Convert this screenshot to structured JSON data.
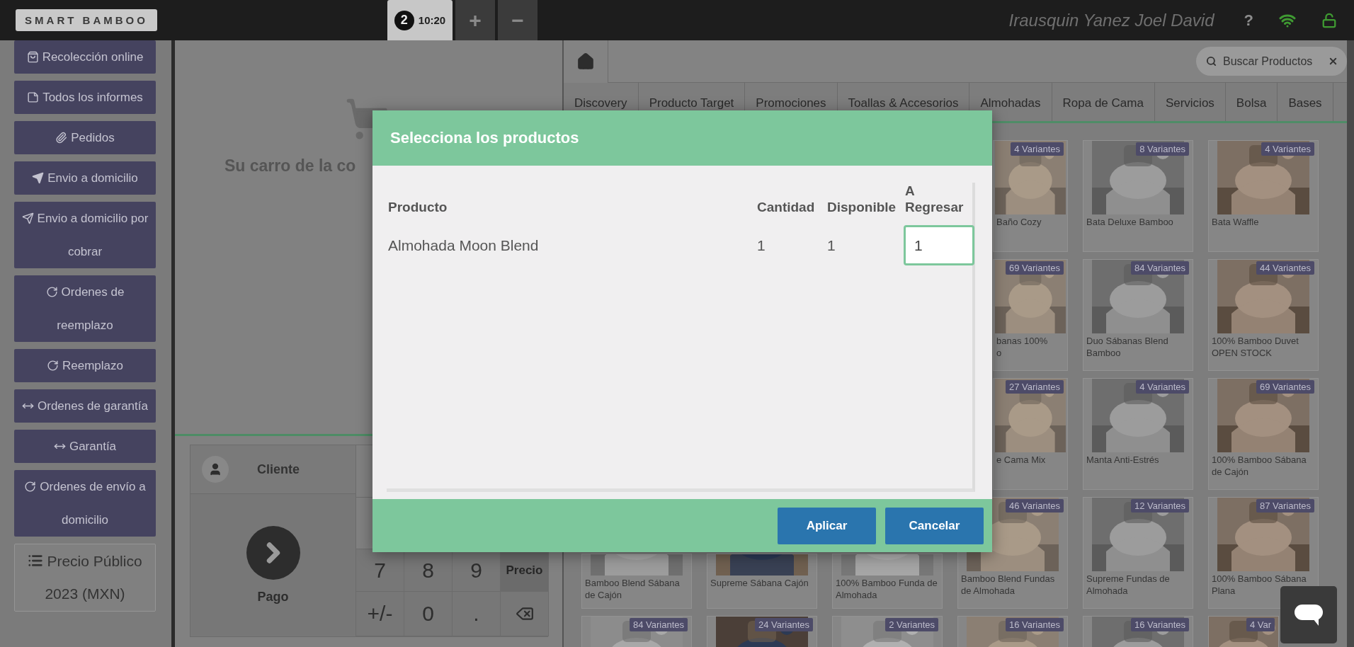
{
  "top_bar": {
    "logo": "SMART BAMBOO",
    "order_tab": {
      "number": "2",
      "time": "10:20",
      "selected": true
    },
    "add_button": "+",
    "remove_button": "−",
    "user_name": "Irausquin Yanez Joel David",
    "help": "?"
  },
  "sidebar": {
    "items": [
      {
        "kind": "button",
        "label": "Recolección online"
      },
      {
        "kind": "button",
        "label": "Todos los informes"
      },
      {
        "kind": "button",
        "label": "Pedidos"
      },
      {
        "kind": "button",
        "label": "Envio a domicilio"
      },
      {
        "kind": "button",
        "label": "Envio a domicilio por cobrar"
      },
      {
        "kind": "button",
        "label": "Ordenes de reemplazo"
      },
      {
        "kind": "button",
        "label": "Reemplazo"
      },
      {
        "kind": "button",
        "label": "Ordenes de garantía"
      },
      {
        "kind": "button",
        "label": "Garantía"
      },
      {
        "kind": "button",
        "label": "Ordenes de envío a domicilio"
      },
      {
        "kind": "price_list",
        "label": "Precio Público 2023 (MXN)"
      }
    ]
  },
  "cart": {
    "empty_text": "Su carro de la co"
  },
  "checkout": {
    "customer": "Cliente",
    "pay": "Pago",
    "keys": [
      {
        "kind": "digit",
        "label": "7"
      },
      {
        "kind": "digit",
        "label": "8"
      },
      {
        "kind": "digit",
        "label": "9"
      },
      {
        "kind": "mode",
        "label": "Precio"
      },
      {
        "kind": "digit",
        "label": "+/-"
      },
      {
        "kind": "digit",
        "label": "0"
      },
      {
        "kind": "digit",
        "label": "."
      },
      {
        "kind": "backspace"
      }
    ]
  },
  "products_panel": {
    "search": {
      "placeholder": "Buscar Productos"
    },
    "tabs": [
      {
        "label": "Discovery",
        "selected": false
      },
      {
        "label": "Producto Target",
        "selected": false
      },
      {
        "label": "Promociones",
        "selected": false
      },
      {
        "label": "Toallas & Accesorios",
        "selected": false
      },
      {
        "label": "Almohadas",
        "selected": false
      },
      {
        "label": "Ropa de Cama",
        "selected": false
      },
      {
        "label": "Servicios",
        "selected": false
      },
      {
        "label": "Bolsa",
        "selected": false
      },
      {
        "label": "Bases",
        "selected": false
      }
    ],
    "rows": [
      {
        "cards": [
          {
            "badge": "4 Variantes",
            "name": "Baño Cozy"
          },
          {
            "badge": "8 Variantes",
            "name": "Bata Deluxe Bamboo"
          },
          {
            "badge": "4 Variantes",
            "name": "Bata Waffle"
          }
        ]
      },
      {
        "cards": [
          {
            "badge": "69 Variantes",
            "name": "banas 100%\no"
          },
          {
            "badge": "84 Variantes",
            "name": "Duo Sábanas Blend Bamboo"
          },
          {
            "badge": "44 Variantes",
            "name": "100% Bamboo Duvet OPEN STOCK"
          }
        ]
      },
      {
        "cards": [
          {
            "badge": "27 Variantes",
            "name": "e Cama Mix"
          },
          {
            "badge": "4 Variantes",
            "name": "Manta Anti-Estrés"
          },
          {
            "badge": "69 Variantes",
            "name": "100% Bamboo Sábana de Cajón"
          }
        ]
      },
      {
        "cards": [
          {
            "name": "Bamboo Blend Sábana de Cajón"
          },
          {
            "name": "Supreme Sábana Cajón"
          },
          {
            "name": "100% Bamboo Funda de Almohada"
          },
          {
            "badge": "46 Variantes",
            "name": "Bamboo Blend Fundas de Almohada"
          },
          {
            "badge": "12 Variantes",
            "name": "Supreme Fundas de Almohada"
          },
          {
            "badge": "87 Variantes",
            "name": "100% Bamboo Sábana Plana"
          }
        ]
      },
      {
        "cards": [
          {
            "badge": "84 Variantes"
          },
          {
            "badge": "24 Variantes"
          },
          {
            "badge": "2 Variantes"
          },
          {
            "badge": "16 Variantes"
          },
          {
            "badge": "16 Variantes"
          },
          {
            "badge": "4 Var"
          }
        ]
      }
    ]
  },
  "modal": {
    "title": "Selecciona los productos",
    "columns": [
      "Producto",
      "Cantidad",
      "Disponible",
      "A Regresar"
    ],
    "rows": [
      {
        "product": "Almohada Moon Blend",
        "quantity": "1",
        "available": "1",
        "to_return": "1"
      }
    ],
    "buttons": [
      "Aplicar",
      "Cancelar"
    ]
  }
}
